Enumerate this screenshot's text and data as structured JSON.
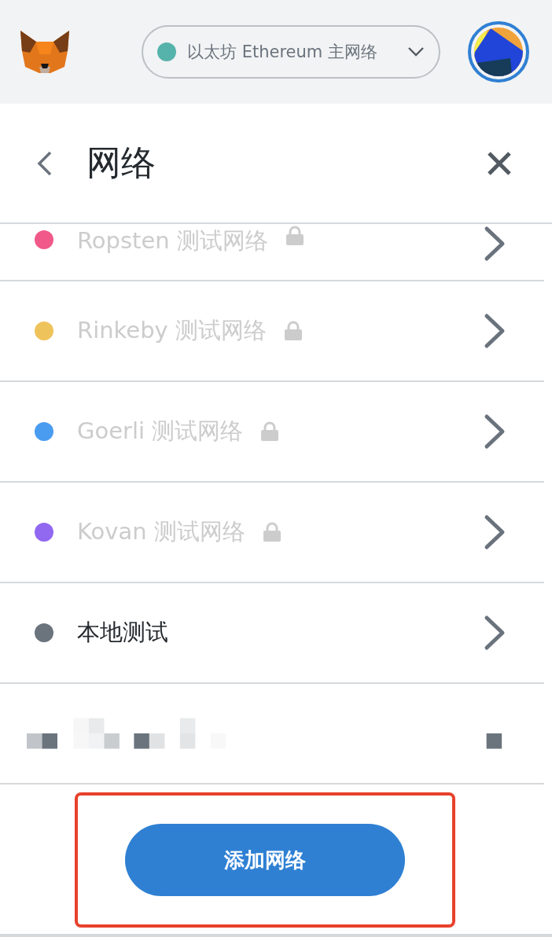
{
  "header": {
    "network": {
      "label": "以太坊 Ethereum 主网络",
      "color": "#56b3ab"
    }
  },
  "page": {
    "title": "网络"
  },
  "networks": [
    {
      "label": "Ropsten 测试网络",
      "color": "#f0598a",
      "locked": true
    },
    {
      "label": "Rinkeby 测试网络",
      "color": "#efc35b",
      "locked": true
    },
    {
      "label": "Goerli 测试网络",
      "color": "#4a9cf0",
      "locked": true
    },
    {
      "label": "Kovan 测试网络",
      "color": "#9168f0",
      "locked": true
    },
    {
      "label": "本地测试",
      "color": "#6b737d",
      "locked": false
    },
    {
      "kind": "picture"
    }
  ],
  "add_button": {
    "label": "添加网络",
    "highlighted": true
  }
}
